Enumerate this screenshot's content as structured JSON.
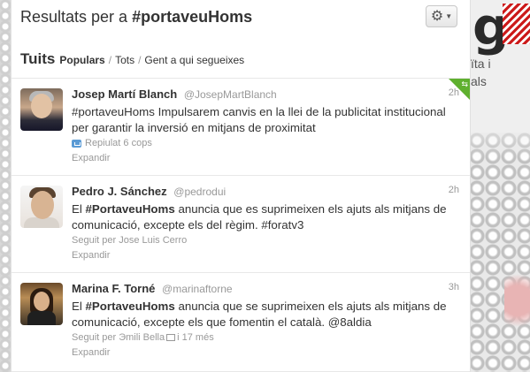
{
  "header": {
    "title_prefix": "Resultats per a ",
    "title_query": "#portaveuHoms"
  },
  "tabs": {
    "main": "Tuits",
    "options": [
      "Populars",
      "Tots",
      "Gent a qui segueixes"
    ],
    "active": "Populars"
  },
  "background": {
    "logo_letter": "g",
    "side_text_1": "ïta i",
    "side_text_2": "als"
  },
  "tweets": [
    {
      "name": "Josep Martí Blanch",
      "handle": "@JosepMartBlanch",
      "time": "2h",
      "text_hashtag": "#portaveuHoms",
      "text_rest": " Impulsarem canvis en la llei de la publicitat institucional per garantir la inversió en mitjans de proximitat",
      "meta": "Repiulat 6 cops",
      "expand": "Expandir"
    },
    {
      "name": "Pedro J. Sánchez",
      "handle": "@pedrodui",
      "time": "2h",
      "text_pre": "El ",
      "text_hashtag": "#PortaveuHoms",
      "text_rest": " anuncia que es suprimeixen els ajuts als mitjans de comunicació, excepte els del règim. #foratv3",
      "meta": "Seguit per Jose Luis Cerro",
      "expand": "Expandir"
    },
    {
      "name": "Marina F. Torné",
      "handle": "@marinaftorne",
      "time": "3h",
      "text_pre": "El ",
      "text_hashtag": "#PortaveuHoms",
      "text_rest": " anuncia que se suprimeixen els ajuts als mitjans de comunicació, excepte els que fomentin el català. @8aldia",
      "meta_a": "Seguit per Эmili Bella",
      "meta_b": "i 17 més",
      "expand": "Expandir"
    }
  ]
}
